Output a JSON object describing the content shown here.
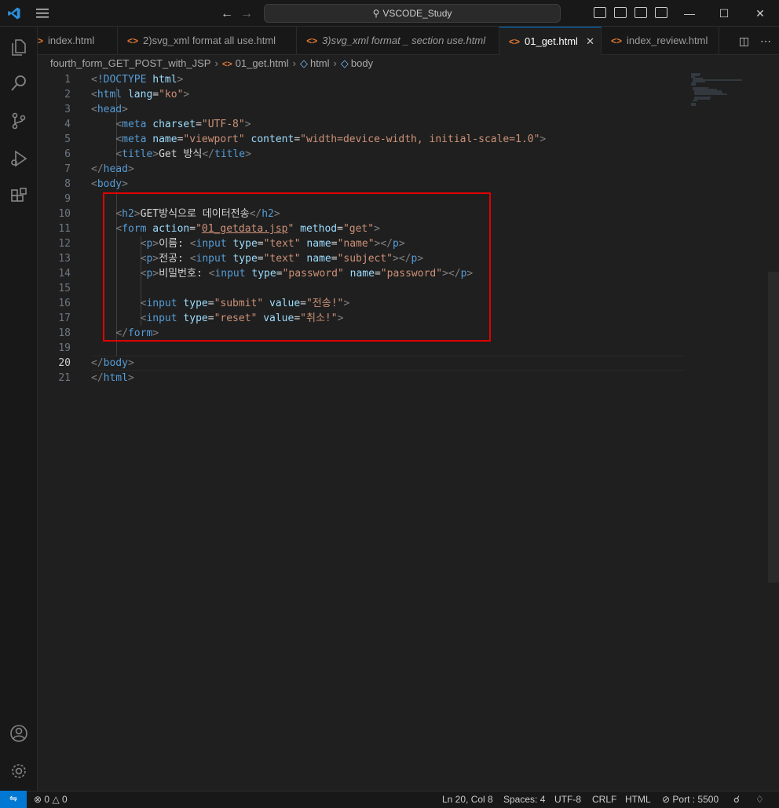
{
  "titlebar": {
    "search_text": "VSCODE_Study"
  },
  "tabs": [
    {
      "label": "index.html",
      "italic": false
    },
    {
      "label": "2)svg_xml format all use.html",
      "italic": false
    },
    {
      "label": "3)svg_xml format _ section use.html",
      "italic": true
    },
    {
      "label": "01_get.html",
      "italic": false,
      "active": true
    },
    {
      "label": "index_review.html",
      "italic": false
    }
  ],
  "breadcrumb": {
    "folder": "fourth_form_GET_POST_with_JSP",
    "file": "01_get.html",
    "el1": "html",
    "el2": "body"
  },
  "code": {
    "l1_doctype": "!DOCTYPE",
    "l1_html": "html",
    "l2_tag": "html",
    "l2_attr": "lang",
    "l2_val": "\"ko\"",
    "l3_tag": "head",
    "l4_tag": "meta",
    "l4_attr": "charset",
    "l4_val": "\"UTF-8\"",
    "l5_tag": "meta",
    "l5_attr1": "name",
    "l5_val1": "\"viewport\"",
    "l5_attr2": "content",
    "l5_val2": "\"width=device-width, initial-scale=1.0\"",
    "l6_tag": "title",
    "l6_text": "Get 방식",
    "l7_tag": "head",
    "l8_tag": "body",
    "l10_tag": "h2",
    "l10_text": "GET방식으로 데이터전송",
    "l11_tag": "form",
    "l11_attr1": "action",
    "l11_val1": "01_getdata.jsp",
    "l11_attr2": "method",
    "l11_val2": "\"get\"",
    "p_tag": "p",
    "input_tag": "input",
    "type_attr": "type",
    "name_attr": "name",
    "value_attr": "value",
    "l12_text": "이름: ",
    "l12_type": "\"text\"",
    "l12_name": "\"name\"",
    "l13_text": "전공: ",
    "l13_type": "\"text\"",
    "l13_name": "\"subject\"",
    "l14_text": "비밀번호: ",
    "l14_type": "\"password\"",
    "l14_name": "\"password\"",
    "l16_type": "\"submit\"",
    "l16_value": "\"전송!\"",
    "l17_type": "\"reset\"",
    "l17_value": "\"취소!\"",
    "l18_tag": "form",
    "l20_tag": "body",
    "l21_tag": "html"
  },
  "line_numbers": [
    "1",
    "2",
    "3",
    "4",
    "5",
    "6",
    "7",
    "8",
    "9",
    "10",
    "11",
    "12",
    "13",
    "14",
    "15",
    "16",
    "17",
    "18",
    "19",
    "20",
    "21"
  ],
  "statusbar": {
    "errors": "0",
    "warnings": "0",
    "position": "Ln 20, Col 8",
    "spaces": "Spaces: 4",
    "encoding": "UTF-8",
    "eol": "CRLF",
    "language": "HTML",
    "port": "Port : 5500"
  },
  "colors": {
    "accent": "#0078d4",
    "highlight_box": "#e00000",
    "tag": "#569cd6",
    "attr": "#9cdcfe",
    "string": "#ce9178"
  }
}
